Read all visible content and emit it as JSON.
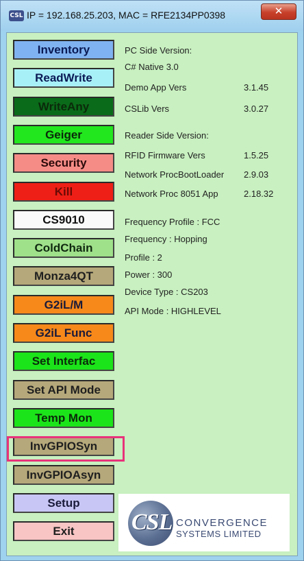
{
  "window": {
    "title": "IP = 192.168.25.203, MAC = RFE2134PP0398",
    "icon_label": "CSL",
    "close_glyph": "✕"
  },
  "buttons": [
    {
      "label": "Inventory",
      "bg": "#7fb2f0",
      "fg": "#0a1a55"
    },
    {
      "label": "ReadWrite",
      "bg": "#a8f0f8",
      "fg": "#0a1a55"
    },
    {
      "label": "WriteAny",
      "bg": "#0a6b1a",
      "fg": "#0a2a0a"
    },
    {
      "label": "Geiger",
      "bg": "#22e61e",
      "fg": "#0a2a0a"
    },
    {
      "label": "Security",
      "bg": "#f58c86",
      "fg": "#2a0a0a"
    },
    {
      "label": "Kill",
      "bg": "#ee1f16",
      "fg": "#6a0a05"
    },
    {
      "label": "CS9010",
      "bg": "#fafafa",
      "fg": "#111111"
    },
    {
      "label": "ColdChain",
      "bg": "#9fe08a",
      "fg": "#102a10"
    },
    {
      "label": "Monza4QT",
      "bg": "#b5a87a",
      "fg": "#1f1f1f"
    },
    {
      "label": "G2iL/M",
      "bg": "#f6891a",
      "fg": "#1a1a3a"
    },
    {
      "label": "G2iL Func",
      "bg": "#f6891a",
      "fg": "#1a1a3a"
    },
    {
      "label": "Set Interfac",
      "bg": "#1ce41a",
      "fg": "#0a2a0a"
    },
    {
      "label": "Set API Mode",
      "bg": "#b5a87a",
      "fg": "#1f1f1f"
    },
    {
      "label": "Temp Mon",
      "bg": "#1ce41a",
      "fg": "#0a2a0a"
    },
    {
      "label": "InvGPIOSyn",
      "bg": "#b5a87a",
      "fg": "#1f1f1f"
    },
    {
      "label": "InvGPIOAsyn",
      "bg": "#b5a87a",
      "fg": "#1f1f1f"
    },
    {
      "label": "Setup",
      "bg": "#c7c6f4",
      "fg": "#1a1a3a"
    },
    {
      "label": "Exit",
      "bg": "#f8c4c4",
      "fg": "#1f1f1f"
    }
  ],
  "highlighted_button": "InvGPIOSyn",
  "highlight_color": "#e8327a",
  "info": {
    "pc_side_header": "PC Side Version:",
    "pc_native": "C# Native 3.0",
    "demo_app_label": "Demo App Vers",
    "demo_app_value": "3.1.45",
    "cslib_label": "CSLib Vers",
    "cslib_value": "3.0.27",
    "reader_side_header": "Reader Side Version:",
    "rfid_fw_label": "RFID Firmware Vers",
    "rfid_fw_value": "1.5.25",
    "boot_label": "Network ProcBootLoader",
    "boot_value": "2.9.03",
    "app_label": "Network Proc  8051 App",
    "app_value": "2.18.32",
    "freq_profile": "Frequency Profile : FCC",
    "frequency": "Frequency : Hopping",
    "profile": "Profile : 2",
    "power": "Power : 300",
    "device_type": "Device Type :   CS203",
    "api_mode": "API Mode : HIGHLEVEL"
  },
  "logo": {
    "mark": "CSL",
    "line1": "CONVERGENCE",
    "line2": "SYSTEMS LIMITED"
  }
}
